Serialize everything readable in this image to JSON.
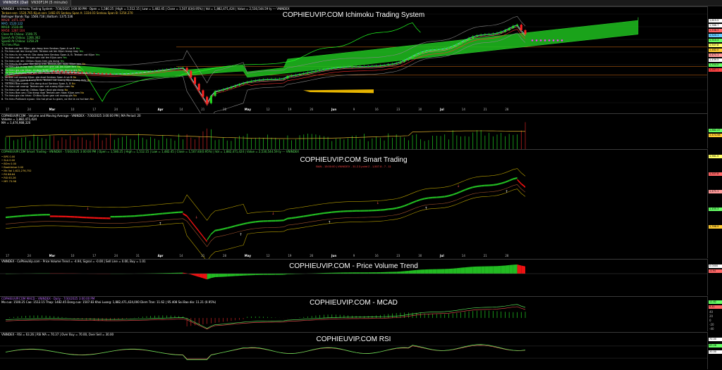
{
  "tabs": [
    "VNINDEX (Daily)",
    "VN30F1M (5 minute)"
  ],
  "panes": {
    "ichimoku": {
      "title": "COPHIEUVIP.COM Ichimoku Trading System",
      "header": "VNINDEX - Ichimoku Trading System - 7/30/2025 3:00:00 PM - Open = 1,580.25 | High = 1,512.15 | Low = 1,482.45 | Close = 1,507.83(0.95%) | Vol = 1,882,471,424 | Value = 2,530,544.59 ty  ---  VNINDEX",
      "lines": [
        {
          "text": "Tenkan-sen: 1520.765  Kijun-sen: 1482.05  Senkou Span A: 1334.03  Senkou Span B: 1254.270",
          "color": "#ffd24a"
        },
        {
          "text": "Bollinger Bands Top: 1566.718 | Bottom: 1375.536",
          "color": "#ffffff"
        },
        {
          "text": "MA20: 1471.129",
          "color": "#ff6a6a"
        },
        {
          "text": "MA5: 1520.122",
          "color": "#6ad0ff"
        },
        {
          "text": "MA10: 1510.49",
          "color": "#5ee65e"
        },
        {
          "text": "MA50: 1287.104",
          "color": "#ff5050"
        },
        {
          "text": "Close At Chikou: 1599.75",
          "color": "#5ee65e"
        },
        {
          "text": "SpanA At Chikou: 1266.362",
          "color": "#5ee65e"
        },
        {
          "text": "SpanB At Chikou: 1258.29",
          "color": "#5ee65e"
        },
        {
          "text": "Tin hieu Mua",
          "color": "#5ee65e"
        }
      ],
      "signals_buy": [
        {
          "text": "1. Tenkan cat len Kijun: gia dang tren Senkou Span A va B",
          "tag": "Yes"
        },
        {
          "text": "2. Tin hieu cat len trung tinh: Tenkan cat len Kijun trong may",
          "tag": "Yes"
        },
        {
          "text": "3. Tin hieu tu tin manh: Gia dong tren Senkou Span A, B. Tenkan cat Kijun",
          "tag": "Yes"
        },
        {
          "text": "4. Tin hieu cat len: Tenkan-sen cat len Kijun-sen",
          "tag": "Yes"
        },
        {
          "text": "5. Tin hieu cat len: Chikou Span tren gia dong",
          "tag": "Yes"
        },
        {
          "text": "6. Tin hieu tu tin yeu: Gia dong tren Tenkan-sen hoac Kijun-sen",
          "tag": "No"
        },
        {
          "text": "7. Tin hieu gia trung tinh: Tenkan-sen gan cat len Kijun-sen",
          "tag": "No"
        },
        {
          "text": "8. Tin hieu gia cac khac: Chikou Span gan cat len duong gia",
          "tag": "No"
        },
        {
          "text": "9. Tin hieu Pullback: Gia sau dao chieu tu tang, co the la co hoi mua",
          "tag": "Yes"
        }
      ],
      "signals_sell": [
        {
          "text": "1. Tenkan cat xuong Kijun: gia duoi Senkou Span A va B",
          "tag": "No"
        },
        {
          "text": "2. Tin hieu cat xuong trung tinh: Tenkan cat xuong Kijun trong may",
          "tag": "No"
        },
        {
          "text": "3. Tin hieu Ban manh: Gia dong duoi Senkou Span A, B",
          "tag": "No"
        },
        {
          "text": "4. Tin hieu cat xuong: Tenkan-sen cat xuong Kijun-sen",
          "tag": "No"
        },
        {
          "text": "5. Tin hieu cat xuong: Chikou Span duoi gia dong",
          "tag": "No"
        },
        {
          "text": "6. Tin hieu Ban yeu: Gia dong duoi Tenkan-sen hoac Kijun-sen",
          "tag": "No"
        },
        {
          "text": "7. Tin hieu gia cac khac: Chikou Span gan cat xuong gia",
          "tag": "No"
        },
        {
          "text": "8. Tin hieu Pullback nguoc: Gia hoi phuc tu giam, co the la co hoi ban",
          "tag": "No"
        }
      ],
      "price_labels": [
        {
          "text": "1,615.5",
          "bg": "#ffffff"
        },
        {
          "text": "1,566.7",
          "bg": "#ffffff"
        },
        {
          "text": "1,538.3",
          "bg": "#ff6666"
        },
        {
          "text": "1,520.1",
          "bg": "#66ccff"
        },
        {
          "text": "1,510.4",
          "bg": "#66ff66"
        },
        {
          "text": "1,507.8",
          "bg": "#ffff66"
        },
        {
          "text": "1,482.0",
          "bg": "#ffcc33"
        },
        {
          "text": "1,471.1",
          "bg": "#ff9999"
        },
        {
          "text": "1,439.5",
          "bg": "#ffffff"
        },
        {
          "text": "1,334.0",
          "bg": "#66ff66"
        },
        {
          "text": "1,287.1",
          "bg": "#ff4444"
        }
      ]
    },
    "volume": {
      "header": "COPHIEUVIP.COM - Volume and Moving Average - VNINDEX - 7/30/2025 3:00:00 PM | MA Period: 20",
      "sub1": "Volume = 1,882,471,424",
      "sub2": "MA = 1,474,988,320",
      "labels": [
        {
          "text": "1,882.47",
          "bg": "#66ff66"
        },
        {
          "text": "1,474.98",
          "bg": "#ffcc33"
        }
      ]
    },
    "smart": {
      "title": "COPHIEUVIP.COM Smart Trading",
      "subtitle": "BAN - 15:00:00 | VNINDEX - 31.2.3 point 2 - 1,507.8 - 7 - 11",
      "header": "COPHIEUVIP.COM Smart Trading - VNINDEX - 7/30/2025 3:00:00 PM | Open = 1,580.25 | High = 1,512.15 | Low = 1,482.45 | Close = 1,507.83(0.95%) | Vol = 1,882,471,424 | Value = 2,530,544.59 ty  ---  VNINDEX",
      "stats": [
        {
          "k": "BPS",
          "v": "0.00"
        },
        {
          "k": "SLA",
          "v": "0.00"
        },
        {
          "k": "BOm",
          "v": "0.00"
        },
        {
          "k": "BookValue",
          "v": "0.00"
        },
        {
          "k": "Ma Vol",
          "v": "1,622,276,752"
        },
        {
          "k": "RS",
          "v": "86.64"
        },
        {
          "k": "RSI",
          "v": "63.26"
        },
        {
          "k": "MFI",
          "v": "73.98"
        }
      ],
      "labels": [
        {
          "text": "1,561.5",
          "bg": "#ffff66"
        },
        {
          "text": "1,507.8",
          "bg": "#ff6666"
        },
        {
          "text": "1,471.1",
          "bg": "#ff9999"
        },
        {
          "text": "1,455.3",
          "bg": "#66ff66"
        },
        {
          "text": "1,398.9",
          "bg": "#ffcc33"
        }
      ]
    },
    "pvt": {
      "title": "COPHIEUVIP.COM - Price Volume Trend",
      "header": "VNINDEX - CoPhieuVip.com - Price Volume Trend = -4.94,  Signal = -0.00  |  Sell Line = 0.00, Buy = 1.01",
      "labels": [
        {
          "text": "0.0000",
          "bg": "#ffffff"
        },
        {
          "text": "-4.94",
          "bg": "#ff6666"
        }
      ]
    },
    "macd": {
      "title": "COPHIEUVIP.COM - MCAD",
      "header": "COPHIEUVIP.COM MACD - VNINDEX - Daily - 7/30/2025 3:00:00 PM",
      "sub": "Mo cua: 1500.25  Cao: 1512.15  Thap: 1482.45  Dong cua: 1507.83  Khoi Luong: 1,882,471,424,000  Diem Tran: 11.62 | 95.408  Sai Bao dio: 11.21 (0.95%)",
      "labels": [
        {
          "text": "11.62",
          "bg": "#66ff66"
        },
        {
          "text": "9.41",
          "bg": "#ff6666"
        }
      ],
      "ticks": [
        "40",
        "20",
        "0",
        "-20",
        "-40"
      ]
    },
    "rsi": {
      "title": "COPHIEUVIP.COM RSI",
      "header": "VNINDEX - RSI = 63.26  |  RSI MA = 70.37  |  Over Buy = 70.00, Over Sell = 30.00",
      "labels": [
        {
          "text": "70.00",
          "bg": "#ffffff"
        },
        {
          "text": "63.26",
          "bg": "#66ff66"
        },
        {
          "text": "30.00",
          "bg": "#ffffff"
        }
      ]
    }
  },
  "x_axis": [
    "17",
    "24",
    "Mar",
    "10",
    "17",
    "24",
    "31",
    "Apr",
    "14",
    "21",
    "28",
    "May",
    "12",
    "19",
    "26",
    "Jun",
    "9",
    "16",
    "23",
    "30",
    "Jul",
    "14",
    "21",
    "28"
  ],
  "colors": {
    "up": "#22dd22",
    "down": "#ff2222",
    "cloud": "#22cc22",
    "bg": "#000000",
    "grid": "#2a2a2a",
    "yellow": "#ffd200"
  }
}
